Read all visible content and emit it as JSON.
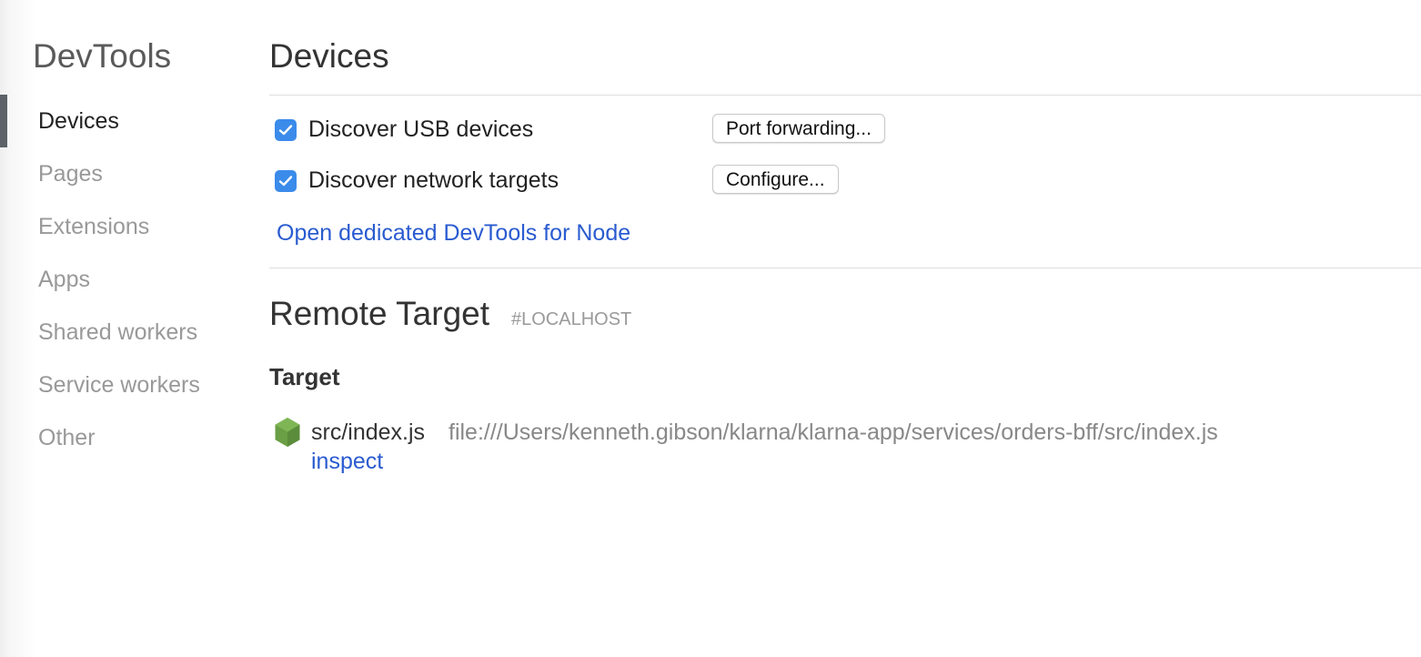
{
  "sidebar": {
    "title": "DevTools",
    "items": [
      {
        "label": "Devices",
        "active": true
      },
      {
        "label": "Pages",
        "active": false
      },
      {
        "label": "Extensions",
        "active": false
      },
      {
        "label": "Apps",
        "active": false
      },
      {
        "label": "Shared workers",
        "active": false
      },
      {
        "label": "Service workers",
        "active": false
      },
      {
        "label": "Other",
        "active": false
      }
    ]
  },
  "main": {
    "title": "Devices",
    "options": [
      {
        "label": "Discover USB devices",
        "checked": true,
        "button_label": "Port forwarding..."
      },
      {
        "label": "Discover network targets",
        "checked": true,
        "button_label": "Configure..."
      }
    ],
    "node_link": "Open dedicated DevTools for Node",
    "remote": {
      "title": "Remote Target",
      "tag": "#LOCALHOST",
      "section_heading": "Target",
      "targets": [
        {
          "icon": "nodejs-hexagon-icon",
          "name": "src/index.js",
          "url": "file:///Users/kenneth.gibson/klarna/klarna-app/services/orders-bff/src/index.js",
          "action": "inspect"
        }
      ]
    }
  },
  "colors": {
    "link": "#2a5bd0",
    "checkbox": "#3b8beb",
    "active_indicator": "#5d6269",
    "node_green": "#6a9f45"
  }
}
